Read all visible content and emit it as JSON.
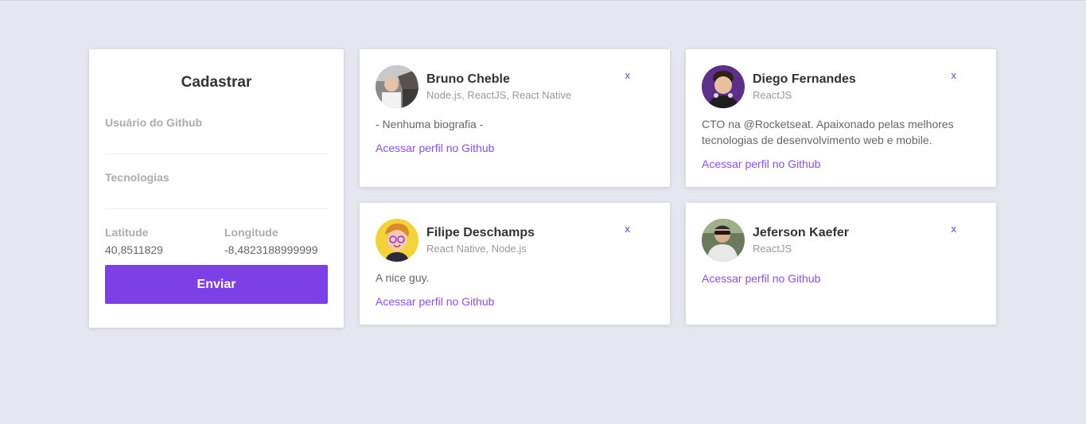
{
  "form": {
    "title": "Cadastrar",
    "github_label": "Usuário do Github",
    "github_value": "",
    "techs_label": "Tecnologias",
    "techs_value": "",
    "latitude_label": "Latitude",
    "latitude_value": "40,8511829",
    "longitude_label": "Longitude",
    "longitude_value": "-8,4823188999999",
    "submit_label": "Enviar"
  },
  "devs": [
    {
      "name": "Bruno Cheble",
      "techs": "Node.js, ReactJS, React Native",
      "bio": "- Nenhuma biografia -",
      "link": "Acessar perfil no Github",
      "close": "x",
      "avatar_icon": "photo-avatar-icon"
    },
    {
      "name": "Diego Fernandes",
      "techs": "ReactJS",
      "bio": "CTO na @Rocketseat. Apaixonado pelas melhores tecnologias de desenvolvimento web e mobile.",
      "link": "Acessar perfil no Github",
      "close": "x",
      "avatar_icon": "photo-avatar-icon"
    },
    {
      "name": "Filipe Deschamps",
      "techs": "React Native, Node.js",
      "bio": "A nice guy.",
      "link": "Acessar perfil no Github",
      "close": "x",
      "avatar_icon": "cartoon-avatar-icon"
    },
    {
      "name": "Jeferson Kaefer",
      "techs": "ReactJS",
      "bio": "",
      "link": "Acessar perfil no Github",
      "close": "x",
      "avatar_icon": "photo-avatar-icon"
    }
  ],
  "colors": {
    "background": "#e6e6f0",
    "primary": "#7d40e7",
    "link": "#8e4dff"
  }
}
